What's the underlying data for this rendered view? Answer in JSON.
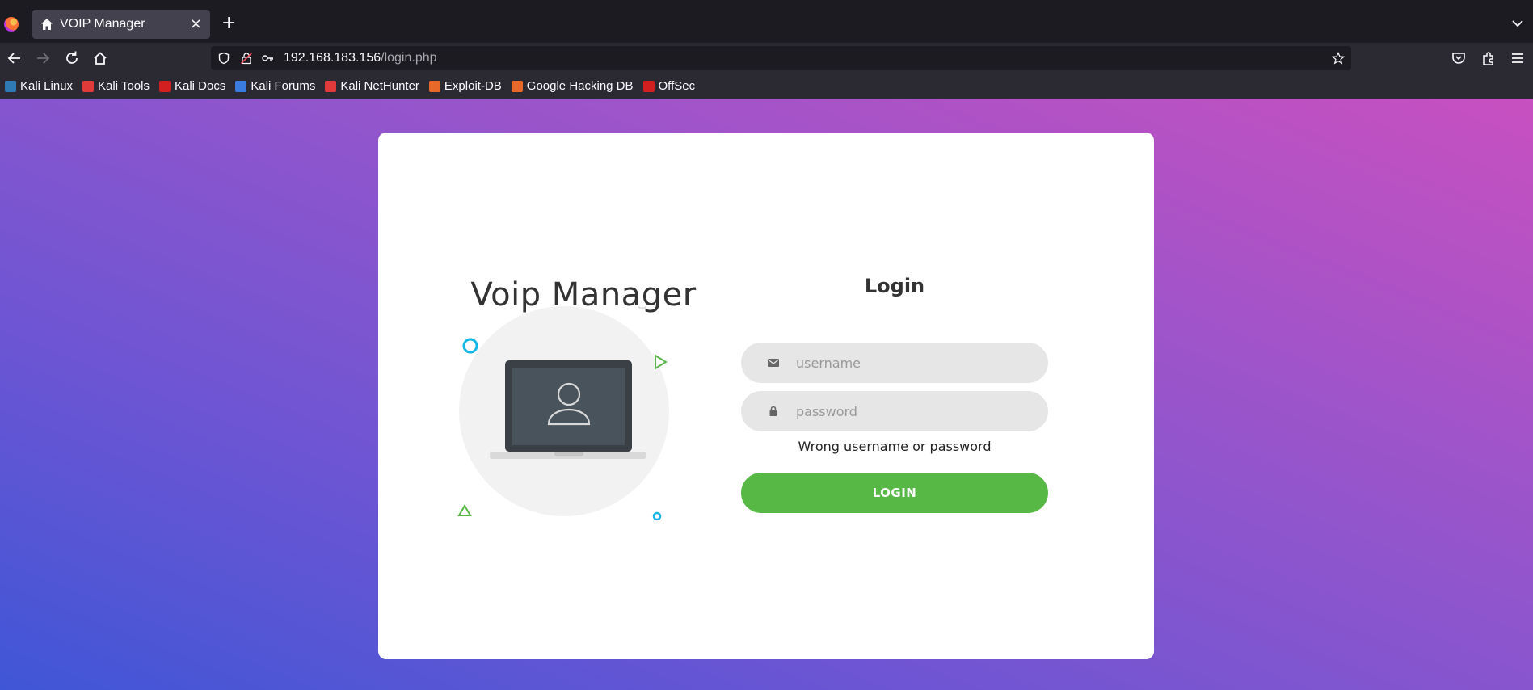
{
  "browser": {
    "tab": {
      "title": "VOIP Manager",
      "close_glyph": "×",
      "icon": "house-icon"
    },
    "new_tab_glyph": "+",
    "url": {
      "host": "192.168.183.156",
      "path": "/login.php"
    },
    "bookmarks": [
      {
        "label": "Kali Linux",
        "icon_color": "#2f7ab4"
      },
      {
        "label": "Kali Tools",
        "icon_color": "#e03a3a"
      },
      {
        "label": "Kali Docs",
        "icon_color": "#d21f1f"
      },
      {
        "label": "Kali Forums",
        "icon_color": "#3a7be0"
      },
      {
        "label": "Kali NetHunter",
        "icon_color": "#e03a3a"
      },
      {
        "label": "Exploit-DB",
        "icon_color": "#e8682a"
      },
      {
        "label": "Google Hacking DB",
        "icon_color": "#e8682a"
      },
      {
        "label": "OffSec",
        "icon_color": "#d21f1f"
      }
    ]
  },
  "page": {
    "brand_title": "Voip Manager",
    "login_title": "Login",
    "username_placeholder": "username",
    "password_placeholder": "password",
    "error_message": "Wrong username or password",
    "login_button": "LOGIN",
    "colors": {
      "accent_green": "#57b846",
      "field_bg": "#e6e6e6",
      "gradient_start": "#3f56d6",
      "gradient_end": "#c850c0"
    }
  }
}
